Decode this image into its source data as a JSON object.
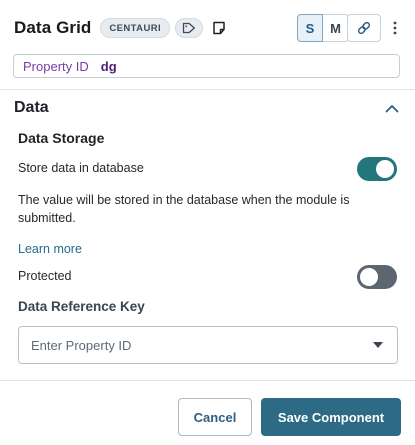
{
  "header": {
    "title": "Data Grid",
    "badge": "CENTAURI",
    "size_small": "S",
    "size_medium": "M"
  },
  "property_id": {
    "label": "Property ID",
    "value": "dg"
  },
  "section": {
    "title": "Data",
    "subsection_title": "Data Storage",
    "store_label": "Store data in database",
    "store_enabled": true,
    "store_description": "The value will be stored in the database when the module is submitted.",
    "learn_more": "Learn more",
    "protected_label": "Protected",
    "protected_enabled": false,
    "reference_key_title": "Data Reference Key",
    "reference_key_placeholder": "Enter Property ID"
  },
  "footer": {
    "cancel": "Cancel",
    "save": "Save Component"
  },
  "colors": {
    "accent": "#2c6a85",
    "toggle_on": "#23767c",
    "toggle_off": "#5c6670",
    "property_id": "#7a3da8"
  },
  "icons": [
    "tag-icon",
    "note-icon",
    "link-icon",
    "kebab-menu-icon",
    "chevron-up-icon",
    "caret-down-icon"
  ]
}
